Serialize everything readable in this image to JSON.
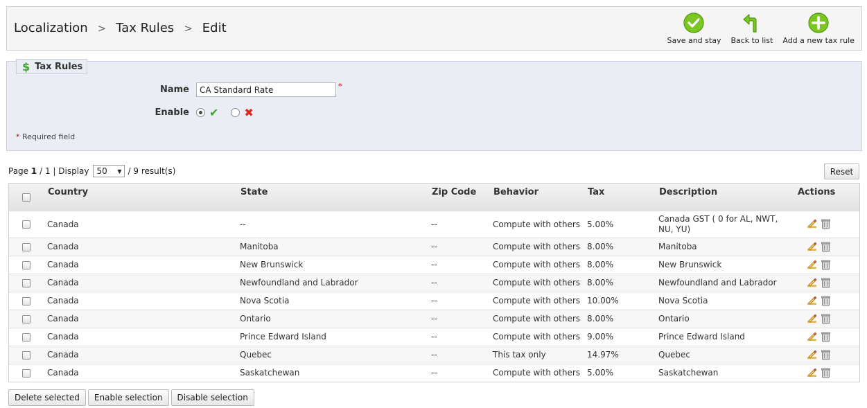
{
  "breadcrumb": [
    "Localization",
    "Tax Rules",
    "Edit"
  ],
  "toolbar": {
    "save_stay": "Save and stay",
    "back": "Back to list",
    "add_new": "Add a new tax rule"
  },
  "form": {
    "legend": "Tax Rules",
    "name_label": "Name",
    "name_value": "CA Standard Rate",
    "enable_label": "Enable",
    "required_note": "Required field",
    "required_star": "*"
  },
  "pager": {
    "page_label": "Page",
    "page_current": "1",
    "page_sep": "/",
    "page_total": "1",
    "display_label": "| Display",
    "per_page": "50",
    "results": "/ 9 result(s)"
  },
  "reset_label": "Reset",
  "columns": [
    "Country",
    "State",
    "Zip Code",
    "Behavior",
    "Tax",
    "Description",
    "Actions"
  ],
  "rows": [
    [
      "Canada",
      "--",
      "--",
      "Compute with others",
      "5.00%",
      "Canada GST ( 0 for AL, NWT, NU, YU)"
    ],
    [
      "Canada",
      "Manitoba",
      "--",
      "Compute with others",
      "8.00%",
      "Manitoba"
    ],
    [
      "Canada",
      "New Brunswick",
      "--",
      "Compute with others",
      "8.00%",
      "New Brunswick"
    ],
    [
      "Canada",
      "Newfoundland and Labrador",
      "--",
      "Compute with others",
      "8.00%",
      "Newfoundland and Labrador"
    ],
    [
      "Canada",
      "Nova Scotia",
      "--",
      "Compute with others",
      "10.00%",
      "Nova Scotia"
    ],
    [
      "Canada",
      "Ontario",
      "--",
      "Compute with others",
      "8.00%",
      "Ontario"
    ],
    [
      "Canada",
      "Prince Edward Island",
      "--",
      "Compute with others",
      "9.00%",
      "Prince Edward Island"
    ],
    [
      "Canada",
      "Quebec",
      "--",
      "This tax only",
      "14.97%",
      "Quebec"
    ],
    [
      "Canada",
      "Saskatchewan",
      "--",
      "Compute with others",
      "5.00%",
      "Saskatchewan"
    ]
  ],
  "bulk": {
    "delete": "Delete selected",
    "enable": "Enable selection",
    "disable": "Disable selection"
  },
  "icons": {
    "save": "check-circle-icon",
    "back": "return-arrow-icon",
    "add": "plus-circle-icon",
    "edit": "pencil-icon",
    "delete": "trash-icon"
  },
  "colors": {
    "accent_green": "#3aa52d",
    "error_red": "#e0261f",
    "panel_bg": "#ebedf4"
  }
}
